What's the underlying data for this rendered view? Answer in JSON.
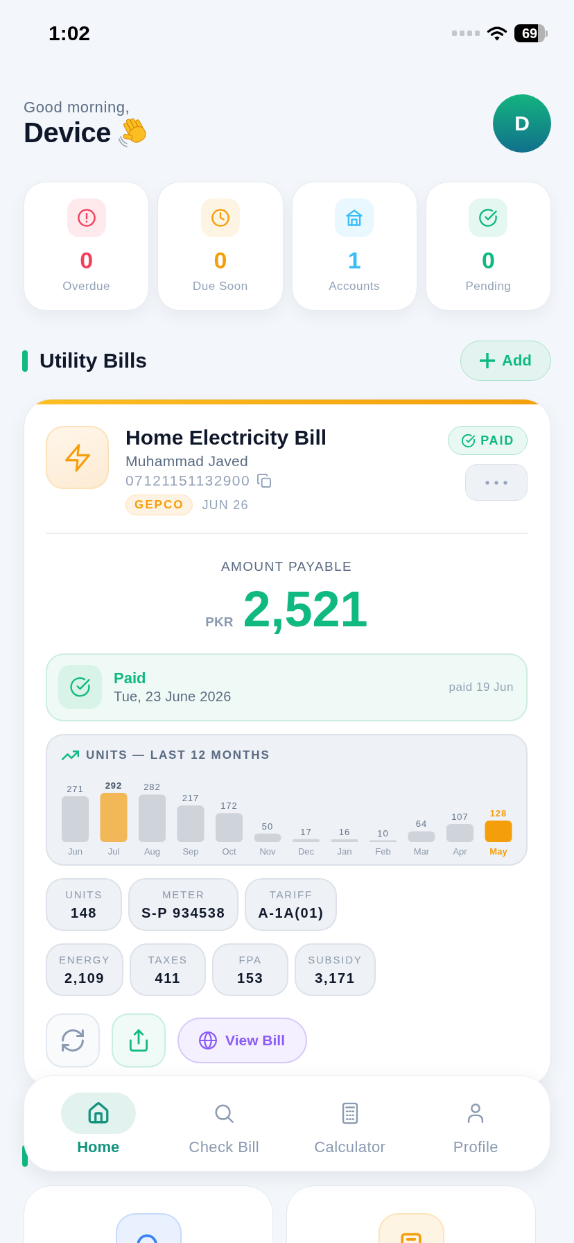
{
  "status_bar": {
    "time": "1:02",
    "battery": "69"
  },
  "header": {
    "greeting": "Good morning,",
    "name": "Device",
    "avatar_initial": "D"
  },
  "stats": [
    {
      "kind": "overdue",
      "value": "0",
      "label": "Overdue",
      "color": "#f43f5e"
    },
    {
      "kind": "due_soon",
      "value": "0",
      "label": "Due Soon",
      "color": "#f59e0b"
    },
    {
      "kind": "accounts",
      "value": "1",
      "label": "Accounts",
      "color": "#38bdf8"
    },
    {
      "kind": "pending",
      "value": "0",
      "label": "Pending",
      "color": "#10b981"
    }
  ],
  "utility_bills": {
    "title": "Utility Bills",
    "add_button": "Add",
    "bills": [
      {
        "kind": "electricity",
        "title": "Home Electricity Bill",
        "holder": "Muhammad Javed",
        "account_number": "07121151132900",
        "provider": "GEPCO",
        "month": "JUN 26",
        "status": {
          "kind": "paid",
          "label": "PAID"
        },
        "amount": {
          "label": "AMOUNT PAYABLE",
          "currency": "PKR",
          "value": "2,521"
        },
        "payment": {
          "kind": "paid",
          "title": "Paid",
          "date": "Tue, 23 June 2026",
          "note": "paid 19 Jun"
        },
        "usage": {
          "chart_data": {
            "type": "bar",
            "title": "UNITS — LAST 12 MONTHS",
            "categories": [
              "Jun",
              "Jul",
              "Aug",
              "Sep",
              "Oct",
              "Nov",
              "Dec",
              "Jan",
              "Feb",
              "Mar",
              "Apr",
              "May"
            ],
            "values": [
              271,
              292,
              282,
              217,
              172,
              50,
              17,
              16,
              10,
              64,
              107,
              128
            ],
            "data_labels": true
          },
          "bar_states": [
            {
              "highlighted": false,
              "selected": false
            },
            {
              "highlighted": true,
              "selected": false
            },
            {
              "highlighted": false,
              "selected": false
            },
            {
              "highlighted": false,
              "selected": false
            },
            {
              "highlighted": false,
              "selected": false
            },
            {
              "highlighted": false,
              "selected": false
            },
            {
              "highlighted": false,
              "selected": false
            },
            {
              "highlighted": false,
              "selected": false
            },
            {
              "highlighted": false,
              "selected": false
            },
            {
              "highlighted": false,
              "selected": false
            },
            {
              "highlighted": false,
              "selected": false
            },
            {
              "highlighted": false,
              "selected": true
            }
          ]
        },
        "details": [
          {
            "label": "UNITS",
            "value": "148"
          },
          {
            "label": "METER",
            "value": "S-P 934538"
          },
          {
            "label": "TARIFF",
            "value": "A-1A(01)"
          }
        ],
        "charges": [
          {
            "label": "ENERGY",
            "value": "2,109"
          },
          {
            "label": "TAXES",
            "value": "411"
          },
          {
            "label": "FPA",
            "value": "153"
          },
          {
            "label": "SUBSIDY",
            "value": "3,171"
          }
        ],
        "actions": [
          {
            "kind": "refresh"
          },
          {
            "kind": "share"
          },
          {
            "kind": "view",
            "label": "View Bill"
          }
        ]
      }
    ]
  },
  "quick_actions": {
    "cards": [
      {
        "kind": "search",
        "color": "#3b82f6"
      },
      {
        "kind": "document",
        "color": "#f59e0b"
      }
    ]
  },
  "bottom_nav": [
    {
      "kind": "home",
      "label": "Home",
      "selected": true
    },
    {
      "kind": "search",
      "label": "Check Bill",
      "selected": false
    },
    {
      "kind": "calculator",
      "label": "Calculator",
      "selected": false
    },
    {
      "kind": "profile",
      "label": "Profile",
      "selected": false
    }
  ]
}
